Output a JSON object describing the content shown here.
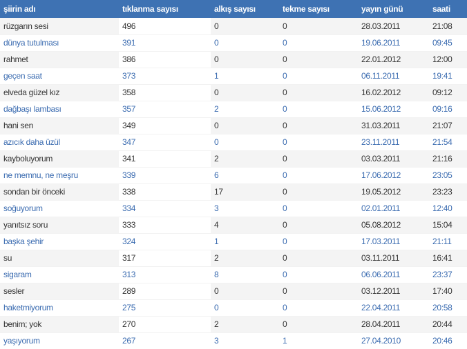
{
  "headers": {
    "name": "şiirin adı",
    "clicks": "tıklanma sayısı",
    "claps": "alkış sayısı",
    "kicks": "tekme sayısı",
    "date": "yayın günü",
    "time": "saati"
  },
  "rows": [
    {
      "name": "rüzgarın sesi",
      "clicks": "496",
      "claps": "0",
      "kicks": "0",
      "date": "28.03.2011",
      "time": "21:08"
    },
    {
      "name": "dünya tutulması",
      "clicks": "391",
      "claps": "0",
      "kicks": "0",
      "date": "19.06.2011",
      "time": "09:45"
    },
    {
      "name": "rahmet",
      "clicks": "386",
      "claps": "0",
      "kicks": "0",
      "date": "22.01.2012",
      "time": "12:00"
    },
    {
      "name": "geçen saat",
      "clicks": "373",
      "claps": "1",
      "kicks": "0",
      "date": "06.11.2011",
      "time": "19:41"
    },
    {
      "name": "elveda güzel kız",
      "clicks": "358",
      "claps": "0",
      "kicks": "0",
      "date": "16.02.2012",
      "time": "09:12"
    },
    {
      "name": "dağbaşı lambası",
      "clicks": "357",
      "claps": "2",
      "kicks": "0",
      "date": "15.06.2012",
      "time": "09:16"
    },
    {
      "name": "hani sen",
      "clicks": "349",
      "claps": "0",
      "kicks": "0",
      "date": "31.03.2011",
      "time": "21:07"
    },
    {
      "name": "azıcık daha üzül",
      "clicks": "347",
      "claps": "0",
      "kicks": "0",
      "date": "23.11.2011",
      "time": "21:54"
    },
    {
      "name": "kayboluyorum",
      "clicks": "341",
      "claps": "2",
      "kicks": "0",
      "date": "03.03.2011",
      "time": "21:16"
    },
    {
      "name": "ne memnu, ne meşru",
      "clicks": "339",
      "claps": "6",
      "kicks": "0",
      "date": "17.06.2012",
      "time": "23:05"
    },
    {
      "name": "sondan bir önceki",
      "clicks": "338",
      "claps": "17",
      "kicks": "0",
      "date": "19.05.2012",
      "time": "23:23"
    },
    {
      "name": "soğuyorum",
      "clicks": "334",
      "claps": "3",
      "kicks": "0",
      "date": "02.01.2011",
      "time": "12:40"
    },
    {
      "name": "yanıtsız soru",
      "clicks": "333",
      "claps": "4",
      "kicks": "0",
      "date": "05.08.2012",
      "time": "15:04"
    },
    {
      "name": "başka şehir",
      "clicks": "324",
      "claps": "1",
      "kicks": "0",
      "date": "17.03.2011",
      "time": "21:11"
    },
    {
      "name": "su",
      "clicks": "317",
      "claps": "2",
      "kicks": "0",
      "date": "03.11.2011",
      "time": "16:41"
    },
    {
      "name": "sigaram",
      "clicks": "313",
      "claps": "8",
      "kicks": "0",
      "date": "06.06.2011",
      "time": "23:37"
    },
    {
      "name": "sesler",
      "clicks": "289",
      "claps": "0",
      "kicks": "0",
      "date": "03.12.2011",
      "time": "17:40"
    },
    {
      "name": "haketmiyorum",
      "clicks": "275",
      "claps": "0",
      "kicks": "0",
      "date": "22.04.2011",
      "time": "20:58"
    },
    {
      "name": "benim; yok",
      "clicks": "270",
      "claps": "2",
      "kicks": "0",
      "date": "28.04.2011",
      "time": "20:44"
    },
    {
      "name": "yaşıyorum",
      "clicks": "267",
      "claps": "3",
      "kicks": "1",
      "date": "27.04.2010",
      "time": "20:46"
    }
  ],
  "colors": {
    "header_bg": "#3e72b3",
    "header_text": "#ffffff",
    "odd_text": "#333333",
    "even_text": "#3a6bb0",
    "odd_bg": "#f4f4f4",
    "even_bg": "#ffffff"
  }
}
